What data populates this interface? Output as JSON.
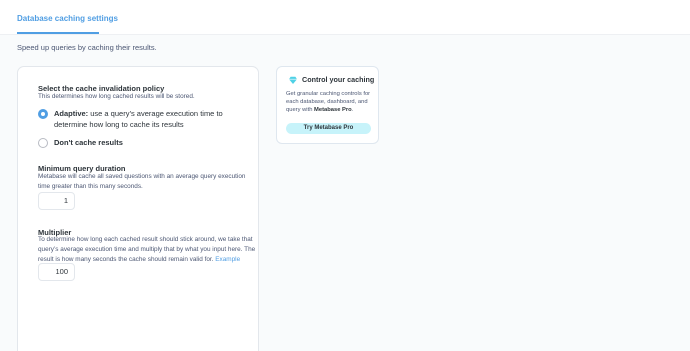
{
  "tabs": {
    "active_label": "Database caching settings"
  },
  "intro_text": "Speed up queries by caching their results.",
  "policy": {
    "title": "Select the cache invalidation policy",
    "description": "This determines how long cached results will be stored.",
    "options": [
      {
        "bold": "Adaptive:",
        "rest": " use a query’s average execution time to determine how long to cache its results",
        "checked": true
      },
      {
        "bold": "Don't cache results",
        "rest": "",
        "checked": false
      }
    ]
  },
  "min_duration": {
    "title": "Minimum query duration",
    "description": "Metabase will cache all saved questions with an average query execution time greater than this many seconds.",
    "value": "1"
  },
  "multiplier": {
    "title": "Multiplier",
    "description": "To determine how long each cached result should stick around, we take that query’s average execution time and multiply that by what you input here. The result is how many seconds the cache should remain valid for.",
    "link": "Example",
    "value": "100"
  },
  "upsell": {
    "icon": "gem-icon",
    "title": "Control your caching",
    "body_prefix": "Get granular caching controls for each database, dashboard, and query with ",
    "body_brand": "Metabase Pro",
    "body_suffix": ".",
    "button": "Try Metabase Pro"
  },
  "colors": {
    "accent": "#509ee3",
    "upsell_button": "#c7f3fa",
    "gem": "#4fd1e6"
  }
}
